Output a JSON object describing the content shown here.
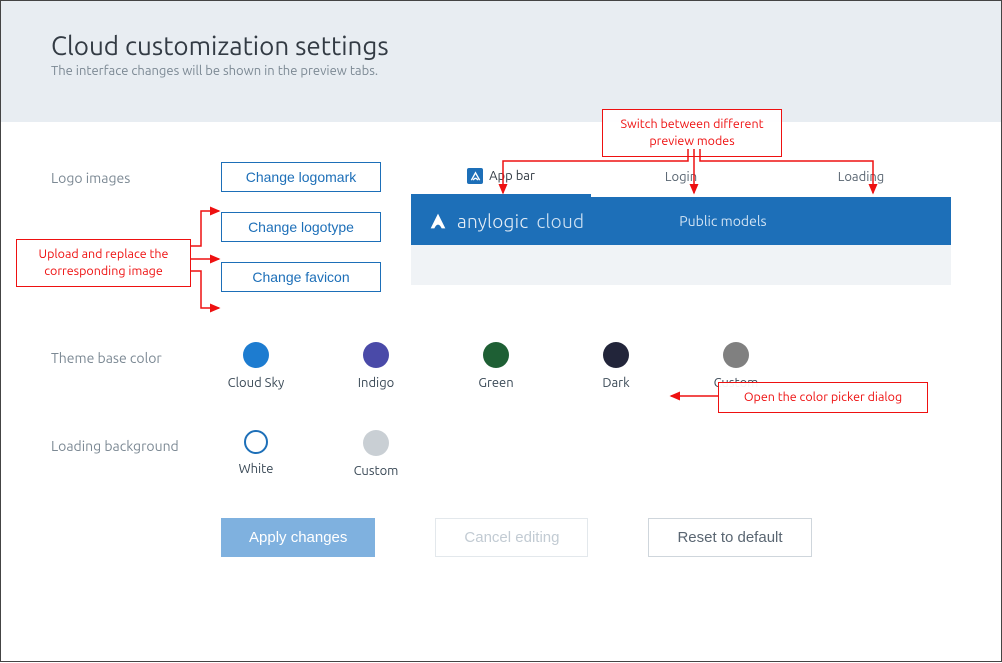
{
  "header": {
    "title": "Cloud customization settings",
    "subtitle": "The interface changes will be shown in the preview tabs."
  },
  "sections": {
    "logo_label": "Logo images",
    "theme_label": "Theme base color",
    "loading_label": "Loading background"
  },
  "logo_buttons": {
    "logomark": "Change logomark",
    "logotype": "Change logotype",
    "favicon": "Change favicon"
  },
  "tabs": {
    "appbar": "App bar",
    "login": "Login",
    "loading": "Loading"
  },
  "appbar": {
    "brand_main": "anylogic",
    "brand_sub": "cloud",
    "nav1": "Public models"
  },
  "theme_colors": [
    {
      "label": "Cloud Sky",
      "hex": "#1d7cd0"
    },
    {
      "label": "Indigo",
      "hex": "#4a4aa8"
    },
    {
      "label": "Green",
      "hex": "#1e5f34"
    },
    {
      "label": "Dark",
      "hex": "#22253a"
    },
    {
      "label": "Custom",
      "hex": "#808080"
    }
  ],
  "loading_bg": [
    {
      "label": "White",
      "outline": true
    },
    {
      "label": "Custom",
      "hex": "#c9cfd4"
    }
  ],
  "footer": {
    "apply": "Apply changes",
    "cancel": "Cancel editing",
    "reset": "Reset to default"
  },
  "callouts": {
    "upload_hint": "Upload and replace the\ncorresponding image",
    "tabs_hint": "Switch between different\npreview modes",
    "color_hint": "Open the color picker dialog"
  }
}
